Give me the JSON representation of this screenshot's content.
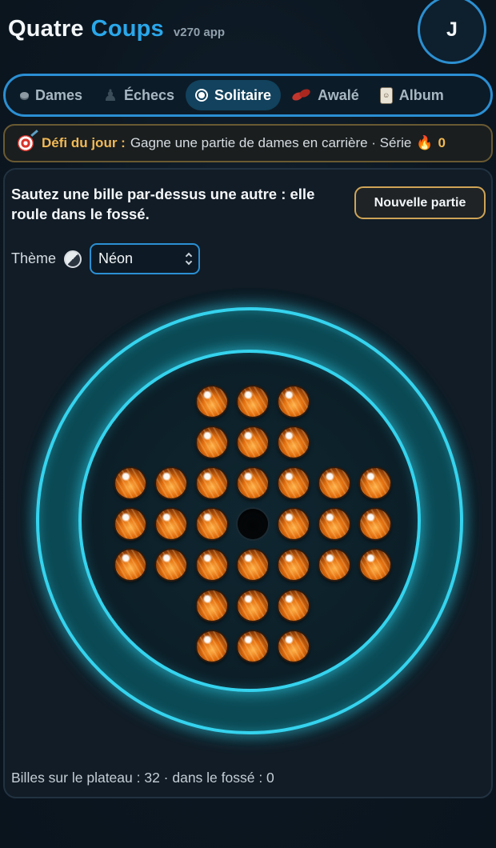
{
  "header": {
    "brand_word1": "Quatre",
    "brand_word2": "Coups",
    "version": "v270 app",
    "avatar_initial": "J"
  },
  "tabs": [
    {
      "label": "Dames",
      "icon": "checker-piece-icon",
      "active": false
    },
    {
      "label": "Échecs",
      "icon": "chess-pawn-icon",
      "active": false
    },
    {
      "label": "Solitaire",
      "icon": "radio-circle-icon",
      "active": true
    },
    {
      "label": "Awalé",
      "icon": "seeds-icon",
      "active": false
    },
    {
      "label": "Album",
      "icon": "album-card-icon",
      "active": false
    }
  ],
  "challenge": {
    "label": "Défi du jour :",
    "text": "Gagne une partie de dames en carrière · Série",
    "streak": "0"
  },
  "game": {
    "instructions": "Sautez une bille par-dessus une autre : elle roule dans le fossé.",
    "new_game_label": "Nouvelle partie",
    "theme_label": "Thème",
    "theme_value": "Néon",
    "stats": "Billes sur le plateau : 32 · dans le fossé : 0"
  },
  "board": {
    "layout": [
      "  XXX  ",
      "  XXX  ",
      "XXXXXXX",
      "XXXOXXX",
      "XXXXXXX",
      "  XXX  ",
      "  XXX  "
    ],
    "marbles_on_board": 32,
    "marbles_in_ditch": 0
  },
  "colors": {
    "accent": "#2aa7ea",
    "neon_ring": "#35d3ee",
    "challenge_gold": "#f1b955",
    "marble_orange": "#e46f0e"
  }
}
